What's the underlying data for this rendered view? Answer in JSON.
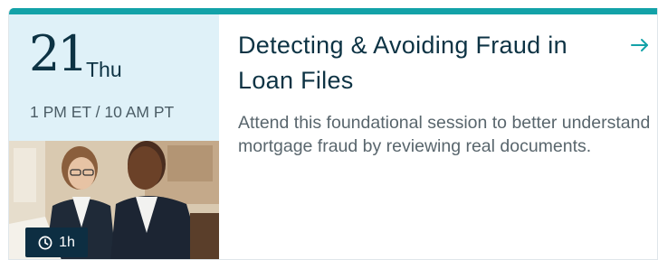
{
  "event": {
    "date_number": "21",
    "day_of_week": "Thu",
    "time": "1 PM ET / 10 AM PT",
    "duration": "1h",
    "title": "Detecting & Avoiding Fraud in Loan Files",
    "description": "Attend this foundational session to better understand mortgage fraud by reviewing real documents.",
    "icons": {
      "duration": "clock-icon",
      "open": "arrow-right-icon"
    }
  },
  "colors": {
    "accent": "#13a2a8",
    "date_panel_bg": "#dff1f8",
    "heading": "#0d3344",
    "badge_bg": "#0d2e42"
  }
}
